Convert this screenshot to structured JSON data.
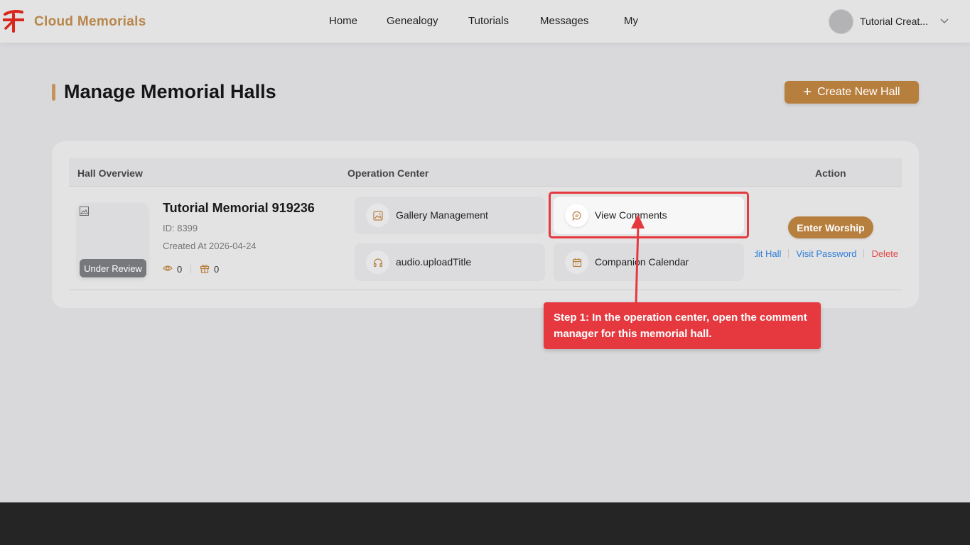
{
  "header": {
    "brand": "Cloud Memorials",
    "logo_icon": "paper-money-icon",
    "nav": [
      {
        "label": "Home"
      },
      {
        "label": "Genealogy"
      },
      {
        "label": "Tutorials"
      },
      {
        "label": "Messages"
      },
      {
        "label": "My"
      }
    ],
    "user": {
      "name": "Tutorial Creat...",
      "avatar_icon": "avatar-icon",
      "dropdown_icon": "chevron-down-icon"
    }
  },
  "page": {
    "title": "Manage Memorial Halls",
    "create_button": "Create New Hall"
  },
  "table": {
    "columns": {
      "overview": "Hall Overview",
      "operations": "Operation Center",
      "action": "Action"
    },
    "rows": [
      {
        "image_icon": "image-placeholder-icon",
        "status": "Under Review",
        "name": "Tutorial Memorial 919236",
        "id": "ID: 8399",
        "created": "Created At 2026-04-24",
        "views": "0",
        "gifts": "0",
        "operations": [
          {
            "label": "Gallery Management",
            "icon": "image-icon"
          },
          {
            "label": "View Comments",
            "icon": "comment-icon"
          },
          {
            "label": "audio.uploadTitle",
            "icon": "headphones-icon"
          },
          {
            "label": "Companion Calendar",
            "icon": "calendar-icon"
          }
        ],
        "enter_button": "Enter Worship",
        "actions": [
          "Edit Hall",
          "Visit Password",
          "Delete"
        ]
      }
    ]
  },
  "callout": {
    "text": "Step 1: In the operation center, open the comment manager for this memorial hall."
  },
  "colors": {
    "accent": "#b77f3d",
    "brand": "#b8864a",
    "highlight": "#e5393f",
    "link": "#2d7ed8",
    "danger": "#e24c4c"
  }
}
